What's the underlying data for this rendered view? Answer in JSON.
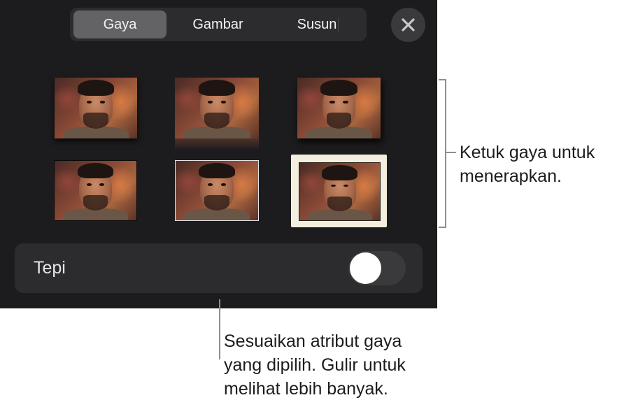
{
  "tabs": [
    {
      "label": "Gaya",
      "active": true
    },
    {
      "label": "Gambar",
      "active": false
    },
    {
      "label": "Susun",
      "active": false
    }
  ],
  "close_icon": "close-x-icon",
  "styles": [
    {
      "name": "style-1",
      "variant": "plain-shadow"
    },
    {
      "name": "style-2",
      "variant": "reflection"
    },
    {
      "name": "style-3",
      "variant": "drop-shadow"
    },
    {
      "name": "style-4",
      "variant": "dark-border"
    },
    {
      "name": "style-5",
      "variant": "thin-frame"
    },
    {
      "name": "style-6",
      "variant": "cream-frame"
    }
  ],
  "border_toggle": {
    "label": "Tepi",
    "on": false
  },
  "callouts": {
    "styles_line1": "Ketuk gaya untuk",
    "styles_line2": "menerapkan.",
    "adjust_line1": "Sesuaikan atribut gaya",
    "adjust_line2": "yang dipilih. Gulir untuk",
    "adjust_line3": "melihat lebih banyak."
  },
  "colors": {
    "panel_bg": "#1c1c1e",
    "control_bg": "#2c2c2e",
    "active_tab": "#636366",
    "frame_cream": "#f3eede"
  }
}
